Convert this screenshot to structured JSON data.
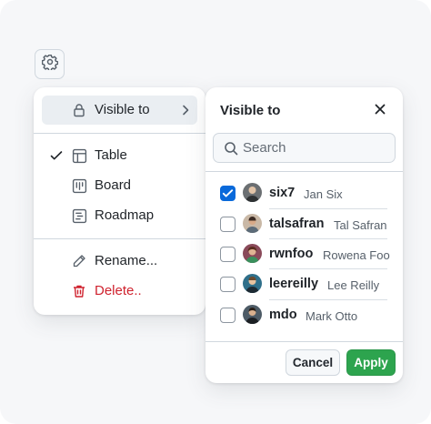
{
  "trigger": {
    "icon": "gear-icon"
  },
  "menu": {
    "items": [
      {
        "label": "Visible to",
        "icon": "lock-icon",
        "has_submenu": true,
        "active": true
      },
      {
        "label": "Table",
        "icon": "table-icon",
        "checked": true
      },
      {
        "label": "Board",
        "icon": "board-icon"
      },
      {
        "label": "Roadmap",
        "icon": "roadmap-icon"
      },
      {
        "label": "Rename...",
        "icon": "pencil-icon"
      },
      {
        "label": "Delete..",
        "icon": "trash-icon",
        "danger": true
      }
    ]
  },
  "panel": {
    "title": "Visible to",
    "search": {
      "placeholder": "Search",
      "value": ""
    },
    "users": [
      {
        "username": "six7",
        "name": "Jan Six",
        "checked": true
      },
      {
        "username": "talsafran",
        "name": "Tal Safran",
        "checked": false
      },
      {
        "username": "rwnfoo",
        "name": "Rowena Foo",
        "checked": false
      },
      {
        "username": "leereilly",
        "name": "Lee Reilly",
        "checked": false
      },
      {
        "username": "mdo",
        "name": "Mark Otto",
        "checked": false
      }
    ],
    "cancel_label": "Cancel",
    "apply_label": "Apply"
  },
  "colors": {
    "accent": "#0969da",
    "apply": "#2da44e",
    "danger": "#cf222e"
  }
}
